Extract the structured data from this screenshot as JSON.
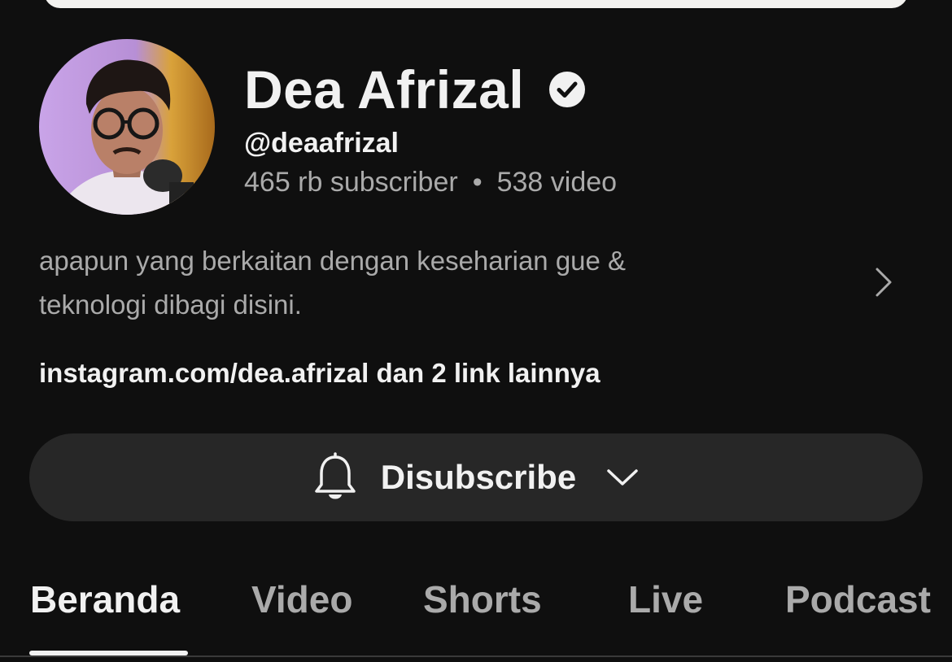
{
  "channel": {
    "name": "Dea Afrizal",
    "handle": "@deaafrizal",
    "subscribers": "465 rb subscriber",
    "separator": "•",
    "videos": "538 video",
    "description_line1": "apapun yang berkaitan dengan keseharian gue &",
    "description_line2": "teknologi dibagi disini.",
    "links": "instagram.com/dea.afrizal dan 2 link lainnya",
    "avatar_icon": "channel-avatar",
    "verified_icon": "verified-check-icon"
  },
  "subscribe": {
    "label": "Disubscribe",
    "icon": "bell-icon",
    "dropdown_icon": "chevron-down-icon"
  },
  "tabs": [
    {
      "label": "Beranda",
      "active": true
    },
    {
      "label": "Video",
      "active": false
    },
    {
      "label": "Shorts",
      "active": false
    },
    {
      "label": "Live",
      "active": false
    },
    {
      "label": "Podcast",
      "active": false
    }
  ],
  "colors": {
    "background": "#0f0f0f",
    "primary_text": "#f1f1f1",
    "secondary_text": "#aaaaaa",
    "button_bg": "#272727"
  }
}
